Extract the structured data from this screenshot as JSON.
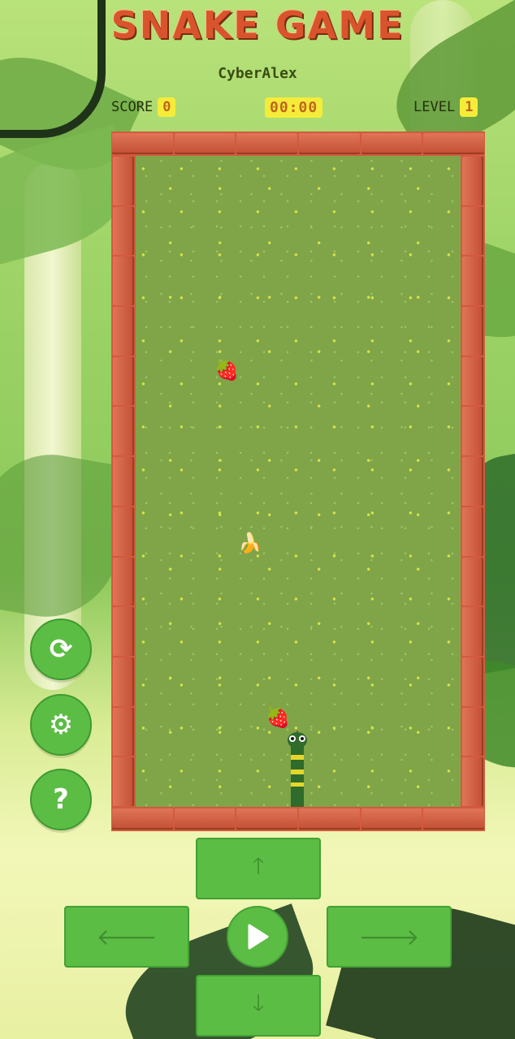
{
  "game": {
    "title": "SNAKE GAME",
    "player_name": "CyberAlex"
  },
  "hud": {
    "score_label": "SCORE",
    "score_value": "0",
    "timer": "00:00",
    "level_label": "LEVEL",
    "level_value": "1"
  },
  "board": {
    "fruits": [
      {
        "type": "strawberry",
        "glyph": "🍓"
      },
      {
        "type": "banana",
        "glyph": "🍌"
      },
      {
        "type": "strawberry",
        "glyph": "🍓"
      }
    ],
    "snake": {
      "segments": 3,
      "direction": "up"
    }
  },
  "side_buttons": [
    {
      "icon": "restart-icon",
      "glyph": "⟳"
    },
    {
      "icon": "settings-icon",
      "glyph": "⚙"
    },
    {
      "icon": "help-icon",
      "glyph": "?"
    }
  ],
  "dpad": {
    "up_glyph": "🡑",
    "left_glyph": "🡐",
    "right_glyph": "🡒",
    "down_glyph": "🡓"
  },
  "colors": {
    "accent_green": "#5cbd45",
    "title_red": "#d9542c",
    "badge_yellow": "#f5ec3a",
    "field_green": "#7fa548",
    "brick_red": "#d25a3e"
  }
}
